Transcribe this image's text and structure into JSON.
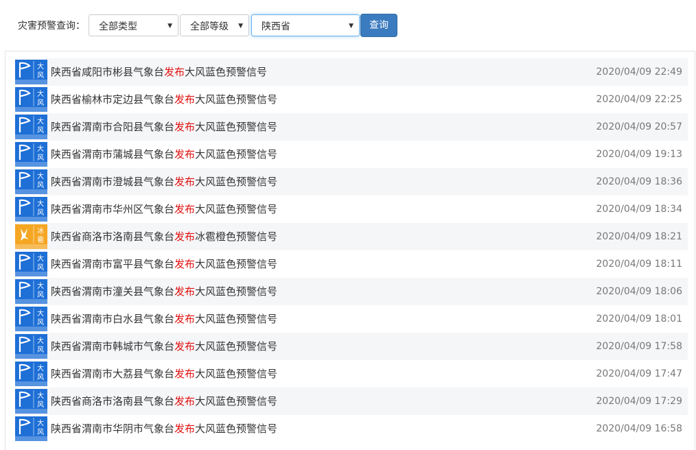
{
  "filter": {
    "label": "灾害预警查询：",
    "type_select": "全部类型",
    "level_select": "全部等级",
    "province_select": "陕西省",
    "query_button": "查询"
  },
  "colors": {
    "accent": "#3b7bbf",
    "highlight": "#e01010",
    "wind_blue": "#1e6fd6",
    "hail_orange": "#f5a623"
  },
  "alerts": [
    {
      "pre": "陕西省咸阳市彬县气象台",
      "verb": "发布",
      "post": "大风蓝色预警信号",
      "time": "2020/04/09 22:49",
      "icon": "wind-blue-warning-icon",
      "icon_top": "大",
      "icon_bottom": "风"
    },
    {
      "pre": "陕西省榆林市定边县气象台",
      "verb": "发布",
      "post": "大风蓝色预警信号",
      "time": "2020/04/09 22:25",
      "icon": "wind-blue-warning-icon",
      "icon_top": "大",
      "icon_bottom": "风"
    },
    {
      "pre": "陕西省渭南市合阳县气象台",
      "verb": "发布",
      "post": "大风蓝色预警信号",
      "time": "2020/04/09 20:57",
      "icon": "wind-blue-warning-icon",
      "icon_top": "大",
      "icon_bottom": "风"
    },
    {
      "pre": "陕西省渭南市蒲城县气象台",
      "verb": "发布",
      "post": "大风蓝色预警信号",
      "time": "2020/04/09 19:13",
      "icon": "wind-blue-warning-icon",
      "icon_top": "大",
      "icon_bottom": "风"
    },
    {
      "pre": "陕西省渭南市澄城县气象台",
      "verb": "发布",
      "post": "大风蓝色预警信号",
      "time": "2020/04/09 18:36",
      "icon": "wind-blue-warning-icon",
      "icon_top": "大",
      "icon_bottom": "风"
    },
    {
      "pre": "陕西省渭南市华州区气象台",
      "verb": "发布",
      "post": "大风蓝色预警信号",
      "time": "2020/04/09 18:34",
      "icon": "wind-blue-warning-icon",
      "icon_top": "大",
      "icon_bottom": "风"
    },
    {
      "pre": "陕西省商洛市洛南县气象台",
      "verb": "发布",
      "post": "冰雹橙色预警信号",
      "time": "2020/04/09 18:21",
      "icon": "hail-orange-warning-icon",
      "icon_top": "冰",
      "icon_bottom": "雹"
    },
    {
      "pre": "陕西省渭南市富平县气象台",
      "verb": "发布",
      "post": "大风蓝色预警信号",
      "time": "2020/04/09 18:11",
      "icon": "wind-blue-warning-icon",
      "icon_top": "大",
      "icon_bottom": "风"
    },
    {
      "pre": "陕西省渭南市潼关县气象台",
      "verb": "发布",
      "post": "大风蓝色预警信号",
      "time": "2020/04/09 18:06",
      "icon": "wind-blue-warning-icon",
      "icon_top": "大",
      "icon_bottom": "风"
    },
    {
      "pre": "陕西省渭南市白水县气象台",
      "verb": "发布",
      "post": "大风蓝色预警信号",
      "time": "2020/04/09 18:01",
      "icon": "wind-blue-warning-icon",
      "icon_top": "大",
      "icon_bottom": "风"
    },
    {
      "pre": "陕西省渭南市韩城市气象台",
      "verb": "发布",
      "post": "大风蓝色预警信号",
      "time": "2020/04/09 17:58",
      "icon": "wind-blue-warning-icon",
      "icon_top": "大",
      "icon_bottom": "风"
    },
    {
      "pre": "陕西省渭南市大荔县气象台",
      "verb": "发布",
      "post": "大风蓝色预警信号",
      "time": "2020/04/09 17:47",
      "icon": "wind-blue-warning-icon",
      "icon_top": "大",
      "icon_bottom": "风"
    },
    {
      "pre": "陕西省商洛市洛南县气象台",
      "verb": "发布",
      "post": "大风蓝色预警信号",
      "time": "2020/04/09 17:29",
      "icon": "wind-blue-warning-icon",
      "icon_top": "大",
      "icon_bottom": "风"
    },
    {
      "pre": "陕西省渭南市华阴市气象台",
      "verb": "发布",
      "post": "大风蓝色预警信号",
      "time": "2020/04/09 16:58",
      "icon": "wind-blue-warning-icon",
      "icon_top": "大",
      "icon_bottom": "风"
    }
  ]
}
